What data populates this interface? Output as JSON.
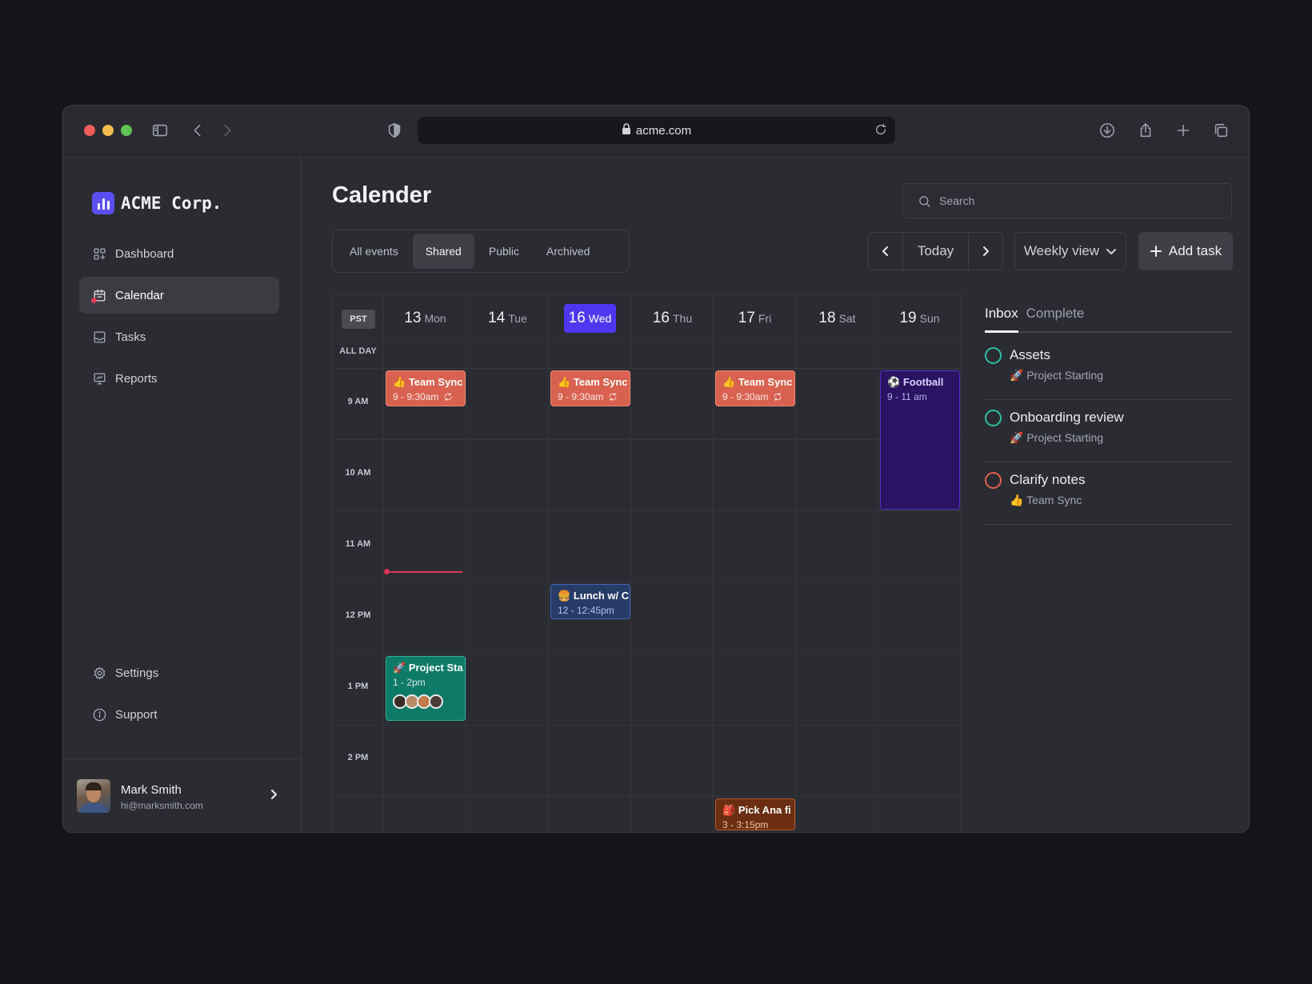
{
  "browser": {
    "url": "acme.com"
  },
  "brand": {
    "name": "ACME Corp.",
    "logo_color": "#5b4ef2"
  },
  "sidebar": {
    "items": [
      {
        "label": "Dashboard",
        "icon": "grid-icon"
      },
      {
        "label": "Calendar",
        "icon": "calendar-icon",
        "active": true
      },
      {
        "label": "Tasks",
        "icon": "inbox-icon"
      },
      {
        "label": "Reports",
        "icon": "presentation-chart-icon"
      }
    ],
    "bottom_items": [
      {
        "label": "Settings",
        "icon": "gear-icon"
      },
      {
        "label": "Support",
        "icon": "info-icon"
      }
    ]
  },
  "profile": {
    "name": "Mark Smith",
    "email": "hi@marksmith.com"
  },
  "page": {
    "title": "Calender"
  },
  "search": {
    "placeholder": "Search"
  },
  "filters": {
    "items": [
      "All events",
      "Shared",
      "Public",
      "Archived"
    ],
    "active": "Shared"
  },
  "toolbar": {
    "today_label": "Today",
    "view_label": "Weekly view",
    "add_label": "Add task"
  },
  "calendar": {
    "timezone": "PST",
    "allday_label": "ALL DAY",
    "days": [
      {
        "num": "13",
        "day": "Mon"
      },
      {
        "num": "14",
        "day": "Tue"
      },
      {
        "num": "16",
        "day": "Wed",
        "today": true
      },
      {
        "num": "16",
        "day": "Thu"
      },
      {
        "num": "17",
        "day": "Fri"
      },
      {
        "num": "18",
        "day": "Sat"
      },
      {
        "num": "19",
        "day": "Sun"
      }
    ],
    "hours": [
      "9 AM",
      "10 AM",
      "11 AM",
      "12 PM",
      "1 PM",
      "2 PM"
    ],
    "events": [
      {
        "emoji": "👍",
        "title": "Team Sync",
        "time": "9 - 9:30am",
        "recurring": true
      },
      {
        "emoji": "👍",
        "title": "Team Sync",
        "time": "9 - 9:30am",
        "recurring": true
      },
      {
        "emoji": "👍",
        "title": "Team Sync",
        "time": "9 - 9:30am",
        "recurring": true
      },
      {
        "emoji": "⚽",
        "title": "Football",
        "time": "9 - 11 am"
      },
      {
        "emoji": "🍔",
        "title": "Lunch w/ C",
        "time": "12 - 12:45pm"
      },
      {
        "emoji": "🚀",
        "title": "Project Sta",
        "time": "1 - 2pm"
      },
      {
        "emoji": "🎒",
        "title": "Pick Ana fi",
        "time": "3 - 3:15pm"
      }
    ],
    "colors": {
      "today": "#5036f0",
      "now_line": "#d9365a",
      "team_sync": "#d8614f",
      "football": "#2a1363",
      "lunch": "#283c68",
      "project": "#0e7a68",
      "pickup": "#6b2e12"
    }
  },
  "panel": {
    "tabs": [
      "Inbox",
      "Complete"
    ],
    "active_tab": "Inbox",
    "tasks": [
      {
        "title": "Assets",
        "emoji": "🚀",
        "subtitle": "Project Starting",
        "status_color": "#2dbfa4"
      },
      {
        "title": "Onboarding review",
        "emoji": "🚀",
        "subtitle": "Project Starting",
        "status_color": "#2dbfa4"
      },
      {
        "title": "Clarify notes",
        "emoji": "👍",
        "subtitle": "Team Sync",
        "status_color": "#e2604d"
      }
    ]
  }
}
